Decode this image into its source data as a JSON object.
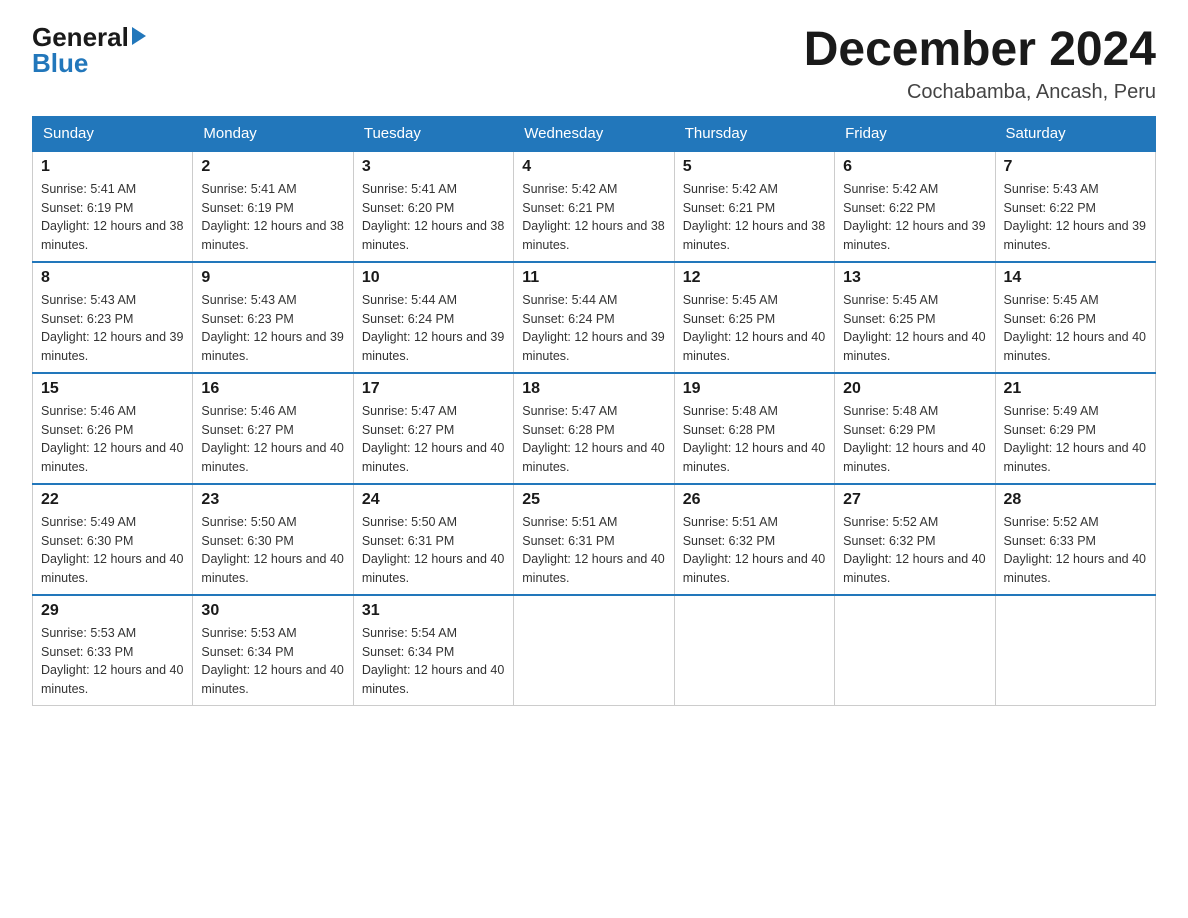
{
  "header": {
    "logo_general": "General",
    "logo_blue": "Blue",
    "main_title": "December 2024",
    "subtitle": "Cochabamba, Ancash, Peru"
  },
  "days_of_week": [
    "Sunday",
    "Monday",
    "Tuesday",
    "Wednesday",
    "Thursday",
    "Friday",
    "Saturday"
  ],
  "weeks": [
    [
      {
        "day": "1",
        "sunrise": "5:41 AM",
        "sunset": "6:19 PM",
        "daylight": "12 hours and 38 minutes."
      },
      {
        "day": "2",
        "sunrise": "5:41 AM",
        "sunset": "6:19 PM",
        "daylight": "12 hours and 38 minutes."
      },
      {
        "day": "3",
        "sunrise": "5:41 AM",
        "sunset": "6:20 PM",
        "daylight": "12 hours and 38 minutes."
      },
      {
        "day": "4",
        "sunrise": "5:42 AM",
        "sunset": "6:21 PM",
        "daylight": "12 hours and 38 minutes."
      },
      {
        "day": "5",
        "sunrise": "5:42 AM",
        "sunset": "6:21 PM",
        "daylight": "12 hours and 38 minutes."
      },
      {
        "day": "6",
        "sunrise": "5:42 AM",
        "sunset": "6:22 PM",
        "daylight": "12 hours and 39 minutes."
      },
      {
        "day": "7",
        "sunrise": "5:43 AM",
        "sunset": "6:22 PM",
        "daylight": "12 hours and 39 minutes."
      }
    ],
    [
      {
        "day": "8",
        "sunrise": "5:43 AM",
        "sunset": "6:23 PM",
        "daylight": "12 hours and 39 minutes."
      },
      {
        "day": "9",
        "sunrise": "5:43 AM",
        "sunset": "6:23 PM",
        "daylight": "12 hours and 39 minutes."
      },
      {
        "day": "10",
        "sunrise": "5:44 AM",
        "sunset": "6:24 PM",
        "daylight": "12 hours and 39 minutes."
      },
      {
        "day": "11",
        "sunrise": "5:44 AM",
        "sunset": "6:24 PM",
        "daylight": "12 hours and 39 minutes."
      },
      {
        "day": "12",
        "sunrise": "5:45 AM",
        "sunset": "6:25 PM",
        "daylight": "12 hours and 40 minutes."
      },
      {
        "day": "13",
        "sunrise": "5:45 AM",
        "sunset": "6:25 PM",
        "daylight": "12 hours and 40 minutes."
      },
      {
        "day": "14",
        "sunrise": "5:45 AM",
        "sunset": "6:26 PM",
        "daylight": "12 hours and 40 minutes."
      }
    ],
    [
      {
        "day": "15",
        "sunrise": "5:46 AM",
        "sunset": "6:26 PM",
        "daylight": "12 hours and 40 minutes."
      },
      {
        "day": "16",
        "sunrise": "5:46 AM",
        "sunset": "6:27 PM",
        "daylight": "12 hours and 40 minutes."
      },
      {
        "day": "17",
        "sunrise": "5:47 AM",
        "sunset": "6:27 PM",
        "daylight": "12 hours and 40 minutes."
      },
      {
        "day": "18",
        "sunrise": "5:47 AM",
        "sunset": "6:28 PM",
        "daylight": "12 hours and 40 minutes."
      },
      {
        "day": "19",
        "sunrise": "5:48 AM",
        "sunset": "6:28 PM",
        "daylight": "12 hours and 40 minutes."
      },
      {
        "day": "20",
        "sunrise": "5:48 AM",
        "sunset": "6:29 PM",
        "daylight": "12 hours and 40 minutes."
      },
      {
        "day": "21",
        "sunrise": "5:49 AM",
        "sunset": "6:29 PM",
        "daylight": "12 hours and 40 minutes."
      }
    ],
    [
      {
        "day": "22",
        "sunrise": "5:49 AM",
        "sunset": "6:30 PM",
        "daylight": "12 hours and 40 minutes."
      },
      {
        "day": "23",
        "sunrise": "5:50 AM",
        "sunset": "6:30 PM",
        "daylight": "12 hours and 40 minutes."
      },
      {
        "day": "24",
        "sunrise": "5:50 AM",
        "sunset": "6:31 PM",
        "daylight": "12 hours and 40 minutes."
      },
      {
        "day": "25",
        "sunrise": "5:51 AM",
        "sunset": "6:31 PM",
        "daylight": "12 hours and 40 minutes."
      },
      {
        "day": "26",
        "sunrise": "5:51 AM",
        "sunset": "6:32 PM",
        "daylight": "12 hours and 40 minutes."
      },
      {
        "day": "27",
        "sunrise": "5:52 AM",
        "sunset": "6:32 PM",
        "daylight": "12 hours and 40 minutes."
      },
      {
        "day": "28",
        "sunrise": "5:52 AM",
        "sunset": "6:33 PM",
        "daylight": "12 hours and 40 minutes."
      }
    ],
    [
      {
        "day": "29",
        "sunrise": "5:53 AM",
        "sunset": "6:33 PM",
        "daylight": "12 hours and 40 minutes."
      },
      {
        "day": "30",
        "sunrise": "5:53 AM",
        "sunset": "6:34 PM",
        "daylight": "12 hours and 40 minutes."
      },
      {
        "day": "31",
        "sunrise": "5:54 AM",
        "sunset": "6:34 PM",
        "daylight": "12 hours and 40 minutes."
      },
      null,
      null,
      null,
      null
    ]
  ],
  "labels": {
    "sunrise_prefix": "Sunrise: ",
    "sunset_prefix": "Sunset: ",
    "daylight_prefix": "Daylight: "
  }
}
